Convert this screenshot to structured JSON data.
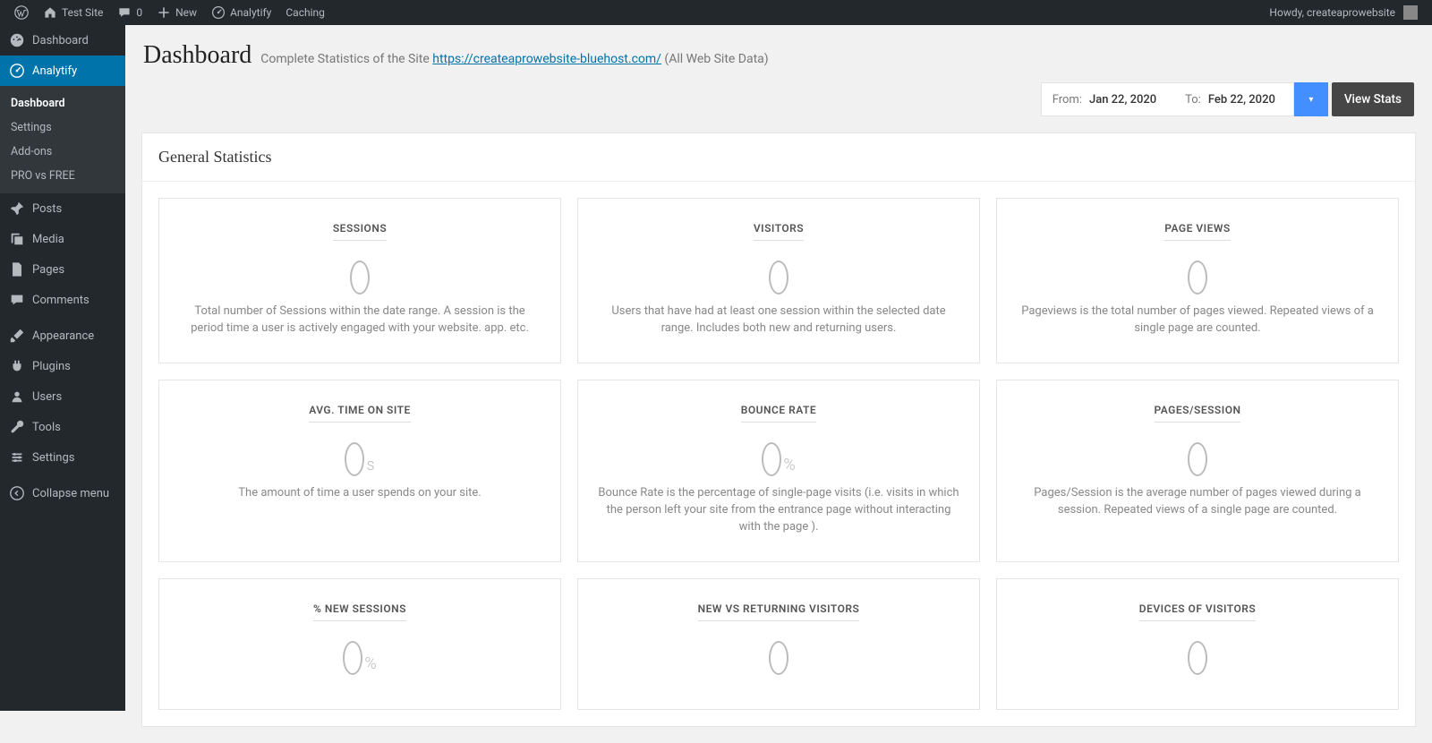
{
  "adminbar": {
    "left": [
      {
        "icon": "wp",
        "label": ""
      },
      {
        "icon": "home",
        "label": "Test Site"
      },
      {
        "icon": "comment",
        "label": "0"
      },
      {
        "icon": "plus",
        "label": "New"
      },
      {
        "icon": "gauge",
        "label": "Analytify"
      },
      {
        "icon": "",
        "label": "Caching"
      }
    ],
    "right": {
      "greeting": "Howdy, createaprowebsite"
    }
  },
  "sidenav": {
    "top": [
      {
        "icon": "dashboard",
        "label": "Dashboard"
      }
    ],
    "current": {
      "icon": "gauge",
      "label": "Analytify"
    },
    "sub": [
      {
        "label": "Dashboard",
        "active": true
      },
      {
        "label": "Settings",
        "active": false
      },
      {
        "label": "Add-ons",
        "active": false
      },
      {
        "label": "PRO vs FREE",
        "active": false
      }
    ],
    "rest": [
      {
        "icon": "pin",
        "label": "Posts"
      },
      {
        "icon": "media",
        "label": "Media"
      },
      {
        "icon": "page",
        "label": "Pages"
      },
      {
        "icon": "comment",
        "label": "Comments"
      },
      {
        "sep": true
      },
      {
        "icon": "brush",
        "label": "Appearance"
      },
      {
        "icon": "plug",
        "label": "Plugins"
      },
      {
        "icon": "user",
        "label": "Users"
      },
      {
        "icon": "wrench",
        "label": "Tools"
      },
      {
        "icon": "settings",
        "label": "Settings"
      },
      {
        "sep": true
      },
      {
        "icon": "collapse",
        "label": "Collapse menu"
      }
    ]
  },
  "header": {
    "title": "Dashboard",
    "subtitle_prefix": "Complete Statistics of the Site ",
    "link_text": "https://createaprowebsite-bluehost.com/",
    "paren": " (All Web Site Data)"
  },
  "date": {
    "from_label": "From:",
    "from_value": "Jan 22, 2020",
    "to_label": "To:",
    "to_value": "Feb 22, 2020",
    "view_label": "View Stats"
  },
  "panel": {
    "title": "General Statistics",
    "cards": [
      {
        "title": "SESSIONS",
        "value": "0",
        "unit": "",
        "desc": "Total number of Sessions within the date range. A session is the period time a user is actively engaged with your website. app. etc."
      },
      {
        "title": "VISITORS",
        "value": "0",
        "unit": "",
        "desc": "Users that have had at least one session within the selected date range. Includes both new and returning users."
      },
      {
        "title": "PAGE VIEWS",
        "value": "0",
        "unit": "",
        "desc": "Pageviews is the total number of pages viewed. Repeated views of a single page are counted."
      },
      {
        "title": "AVG. TIME ON SITE",
        "value": "0",
        "unit": "s",
        "desc": "The amount of time a user spends on your site."
      },
      {
        "title": "BOUNCE RATE",
        "value": "0",
        "unit": "%",
        "desc": "Bounce Rate is the percentage of single-page visits (i.e. visits in which the person left your site from the entrance page without interacting with the page )."
      },
      {
        "title": "PAGES/SESSION",
        "value": "0",
        "unit": "",
        "desc": "Pages/Session is the average number of pages viewed during a session. Repeated views of a single page are counted."
      },
      {
        "title": "% NEW SESSIONS",
        "value": "0",
        "unit": "%",
        "desc": ""
      },
      {
        "title": "NEW VS RETURNING VISITORS",
        "value": "0",
        "unit": "",
        "desc": ""
      },
      {
        "title": "DEVICES OF VISITORS",
        "value": "0",
        "unit": "",
        "desc": ""
      }
    ]
  }
}
